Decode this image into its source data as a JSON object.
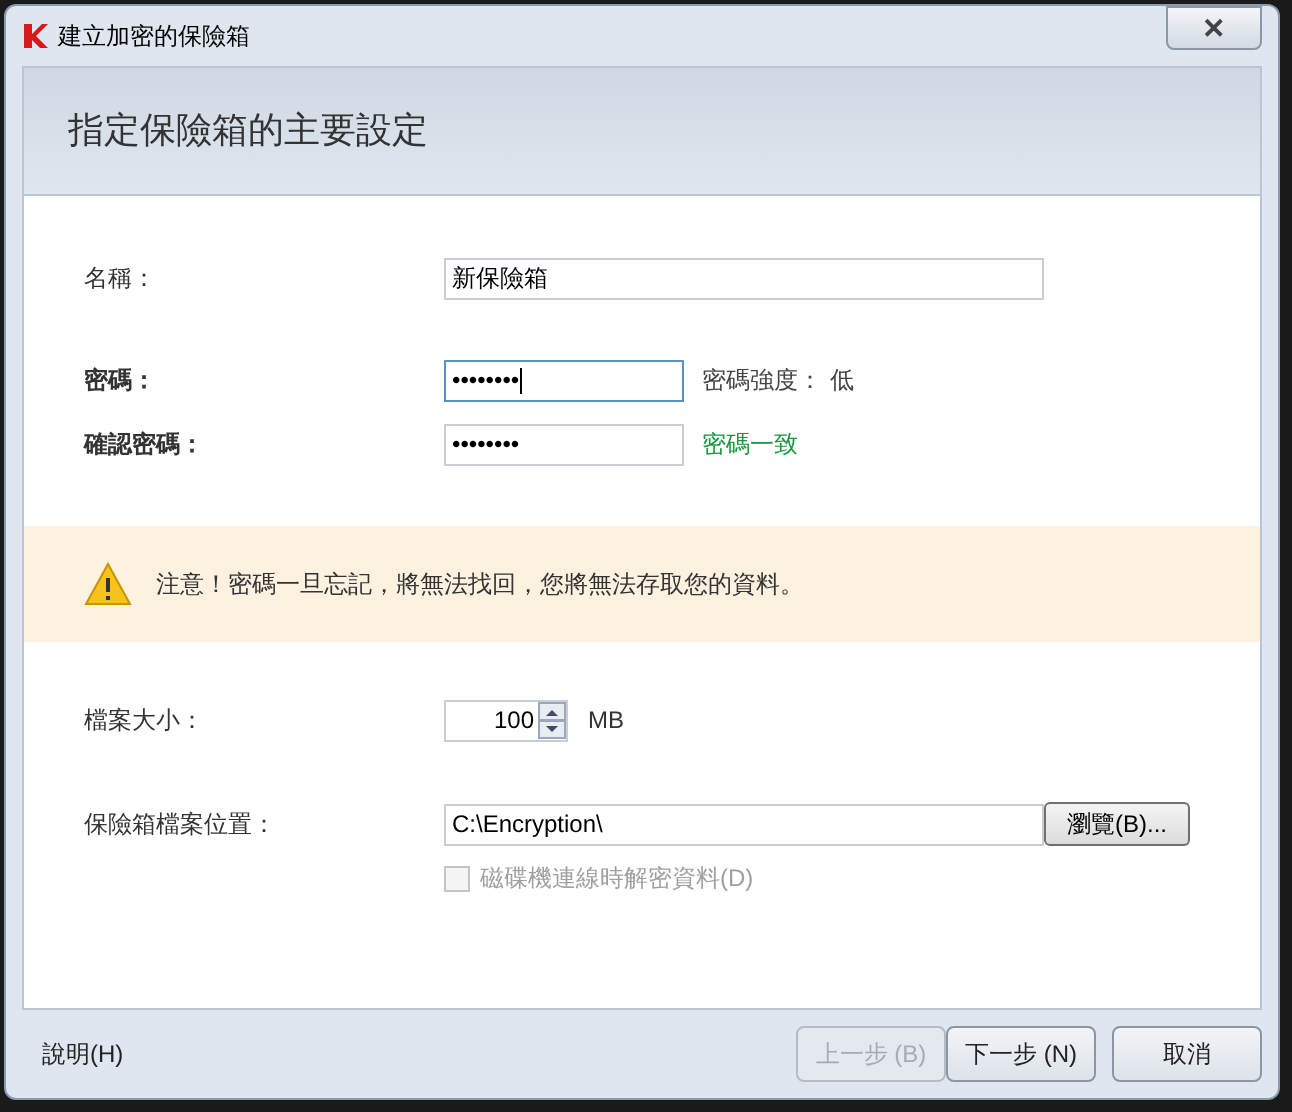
{
  "window": {
    "title": "建立加密的保險箱",
    "close": "✕"
  },
  "header": {
    "title": "指定保險箱的主要設定"
  },
  "name_field": {
    "label": "名稱：",
    "value": "新保險箱"
  },
  "password": {
    "label": "密碼：",
    "value": "••••••••",
    "focused": true,
    "strength_label": "密碼強度：",
    "strength": "低"
  },
  "confirm": {
    "label": "確認密碼：",
    "value": "••••••••",
    "status": "密碼一致",
    "match": true
  },
  "warning": {
    "text": "注意！密碼一旦忘記，將無法找回，您將無法存取您的資料。"
  },
  "size": {
    "label": "檔案大小：",
    "value": "100",
    "unit": "MB"
  },
  "location": {
    "label": "保險箱檔案位置：",
    "value": "C:\\Encryption\\",
    "browse": "瀏覽(B)..."
  },
  "decrypt_option": {
    "label": "磁碟機連線時解密資料(D)",
    "checked": false,
    "disabled": true
  },
  "footer": {
    "help": "說明(H)",
    "buttons": [
      {
        "label": "上一步 (B)",
        "disabled": true
      },
      {
        "label": "下一步 (N)",
        "disabled": false
      },
      {
        "label": "取消",
        "disabled": false
      }
    ]
  }
}
